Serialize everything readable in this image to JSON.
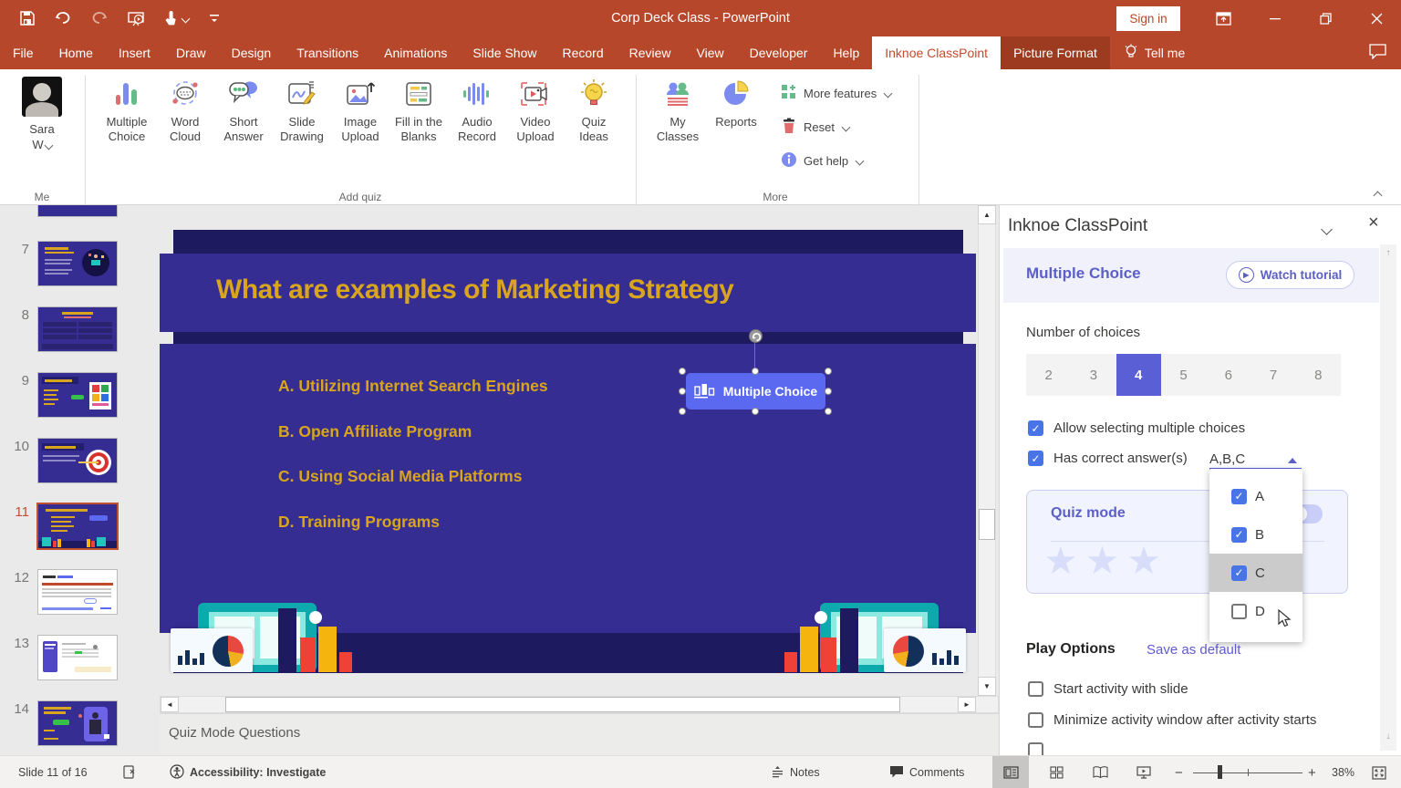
{
  "title_bar": {
    "title": "Corp Deck Class  -  PowerPoint",
    "sign_in_label": "Sign in",
    "qat_icons": [
      "save-icon",
      "undo-icon",
      "redo-icon",
      "slideshow-from-start-icon",
      "touch-mouse-mode-icon",
      "customize-qat-icon"
    ],
    "window_icons": [
      "ribbon-display-options-icon",
      "minimize-icon",
      "restore-icon",
      "close-icon"
    ]
  },
  "ribbon_tabs": {
    "tabs": [
      {
        "label": "File",
        "state": "normal"
      },
      {
        "label": "Home",
        "state": "normal"
      },
      {
        "label": "Insert",
        "state": "normal"
      },
      {
        "label": "Draw",
        "state": "normal"
      },
      {
        "label": "Design",
        "state": "normal"
      },
      {
        "label": "Transitions",
        "state": "normal"
      },
      {
        "label": "Animations",
        "state": "normal"
      },
      {
        "label": "Slide Show",
        "state": "normal"
      },
      {
        "label": "Record",
        "state": "normal"
      },
      {
        "label": "Review",
        "state": "normal"
      },
      {
        "label": "View",
        "state": "normal"
      },
      {
        "label": "Developer",
        "state": "normal"
      },
      {
        "label": "Help",
        "state": "normal"
      },
      {
        "label": "Inknoe ClassPoint",
        "state": "active"
      },
      {
        "label": "Picture Format",
        "state": "contextual"
      }
    ],
    "tell_me_label": "Tell me"
  },
  "ribbon": {
    "me_group": {
      "user_line1": "Sara",
      "user_line2": "W",
      "group_label": "Me"
    },
    "add_quiz_group": {
      "group_label": "Add quiz",
      "buttons": [
        {
          "label": "Multiple\nChoice",
          "icon": "multiple-choice-icon"
        },
        {
          "label": "Word\nCloud",
          "icon": "word-cloud-icon"
        },
        {
          "label": "Short\nAnswer",
          "icon": "short-answer-icon"
        },
        {
          "label": "Slide\nDrawing",
          "icon": "slide-drawing-icon"
        },
        {
          "label": "Image\nUpload",
          "icon": "image-upload-icon"
        },
        {
          "label": "Fill in the\nBlanks",
          "icon": "fill-in-the-blanks-icon"
        },
        {
          "label": "Audio\nRecord",
          "icon": "audio-record-icon"
        },
        {
          "label": "Video\nUpload",
          "icon": "video-upload-icon"
        },
        {
          "label": "Quiz\nIdeas",
          "icon": "quiz-ideas-icon"
        }
      ]
    },
    "more_group": {
      "group_label": "More",
      "big_buttons": [
        {
          "label": "My\nClasses",
          "icon": "my-classes-icon"
        },
        {
          "label": "Reports",
          "icon": "reports-icon"
        }
      ],
      "small_buttons": [
        {
          "label": "More features",
          "icon": "more-features-icon"
        },
        {
          "label": "Reset",
          "icon": "reset-icon"
        },
        {
          "label": "Get help",
          "icon": "get-help-icon"
        }
      ]
    }
  },
  "slide_panel": {
    "thumbnails": [
      {
        "number": "",
        "variant": "partial",
        "selected": false
      },
      {
        "number": "7",
        "variant": "dark-illustration",
        "selected": false
      },
      {
        "number": "8",
        "variant": "dark-table",
        "selected": false
      },
      {
        "number": "9",
        "variant": "dark-swot",
        "selected": false
      },
      {
        "number": "10",
        "variant": "dark-target",
        "selected": false
      },
      {
        "number": "11",
        "variant": "current",
        "selected": true
      },
      {
        "number": "12",
        "variant": "white-report",
        "selected": false
      },
      {
        "number": "13",
        "variant": "white-dashboard",
        "selected": false
      },
      {
        "number": "14",
        "variant": "dark-person",
        "selected": false
      }
    ]
  },
  "slide": {
    "title": "What are examples of Marketing Strategy",
    "options": [
      "A. Utilizing Internet Search Engines",
      "B. Open Affiliate Program",
      "C. Using Social Media Platforms",
      "D. Training Programs"
    ],
    "mc_button_label": "Multiple Choice"
  },
  "notes_pane": {
    "text": "Quiz Mode Questions"
  },
  "panel": {
    "header_title": "Inknoe ClassPoint",
    "section_title": "Multiple Choice",
    "watch_tutorial_label": "Watch tutorial",
    "number_of_choices_label": "Number of choices",
    "choices": [
      {
        "label": "2",
        "selected": false
      },
      {
        "label": "3",
        "selected": false
      },
      {
        "label": "4",
        "selected": true
      },
      {
        "label": "5",
        "selected": false
      },
      {
        "label": "6",
        "selected": false
      },
      {
        "label": "7",
        "selected": false
      },
      {
        "label": "8",
        "selected": false
      }
    ],
    "allow_multiple_label": "Allow selecting multiple choices",
    "allow_multiple_checked": true,
    "has_correct_label": "Has correct answer(s)",
    "has_correct_checked": true,
    "correct_value": "A,B,C",
    "dropdown_options": [
      {
        "label": "A",
        "checked": true,
        "highlighted": false
      },
      {
        "label": "B",
        "checked": true,
        "highlighted": false
      },
      {
        "label": "C",
        "checked": true,
        "highlighted": true
      },
      {
        "label": "D",
        "checked": false,
        "highlighted": false
      }
    ],
    "quiz_mode_label": "Quiz mode",
    "play_options_label": "Play Options",
    "save_as_default_label": "Save as default",
    "play_options": [
      {
        "label": "Start activity with slide",
        "checked": false
      },
      {
        "label": "Minimize activity window after activity starts",
        "checked": false
      }
    ]
  },
  "status_bar": {
    "slide_indicator": "Slide 11 of 16",
    "accessibility": "Accessibility: Investigate",
    "notes_label": "Notes",
    "comments_label": "Comments",
    "zoom_level": "38%",
    "icons": [
      "proofing-icon",
      "accessibility-icon",
      "notes-icon",
      "comments-icon",
      "normal-view-icon",
      "slide-sorter-icon",
      "reading-view-icon",
      "slideshow-view-icon",
      "zoom-out-icon",
      "zoom-in-icon",
      "fit-slide-icon"
    ]
  },
  "colors": {
    "titlebar_red": "#B7472A",
    "contextual_tab": "#9C3B20",
    "accent_purple": "#5B5FC7",
    "checkbox_blue": "#4874E8",
    "slide_indigo": "#352D91",
    "slide_navy": "#1E1A60",
    "slide_gold": "#D9A51E",
    "mc_button_blue": "#5B69F1",
    "selected_thumb_border": "#C0512F"
  }
}
